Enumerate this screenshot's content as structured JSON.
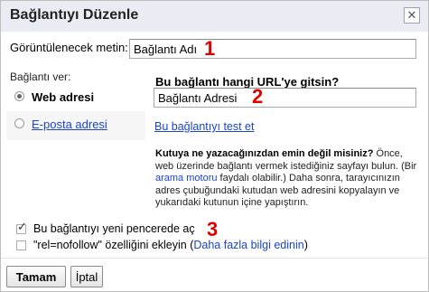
{
  "dialog": {
    "title": "Bağlantıyı Düzenle",
    "close_glyph": "✕"
  },
  "display_text": {
    "label": "Görüntülenecek metin:",
    "value": "Bağlantı Adı",
    "marker": "1"
  },
  "link_to": {
    "label": "Bağlantı ver:",
    "options": [
      {
        "label": "Web adresi",
        "selected": true
      },
      {
        "label": "E-posta adresi",
        "selected": false
      }
    ]
  },
  "url": {
    "question": "Bu bağlantı hangi URL'ye gitsin?",
    "value": "Bağlantı Adresi",
    "marker": "2",
    "test_link": "Bu bağlantıyı test et"
  },
  "hint": {
    "bold": "Kutuya ne yazacağınızdan emin değil misiniz?",
    "part1": " Önce, web üzerinde bağlantı vermek istediğiniz sayfayı bulun. (Bir ",
    "link": "arama motoru",
    "part2": " faydalı olabilir.) Daha sonra, tarayıcınızın adres çubuğundaki kutudan web adresini kopyalayın ve yukarıdaki kutunun içine yapıştırın."
  },
  "options": {
    "new_window": {
      "label": "Bu bağlantıyı yeni pencerede aç",
      "checked": true,
      "marker": "3"
    },
    "nofollow": {
      "label_pre": "\"rel=nofollow\" özelliğini ekleyin (",
      "link": "Daha fazla bilgi edinin",
      "label_post": ")",
      "checked": false
    }
  },
  "buttons": {
    "ok": "Tamam",
    "cancel": "İptal"
  },
  "colors": {
    "accent_marker": "#e00000",
    "link": "#1a44cc",
    "titlebar": "#e9edf3"
  }
}
